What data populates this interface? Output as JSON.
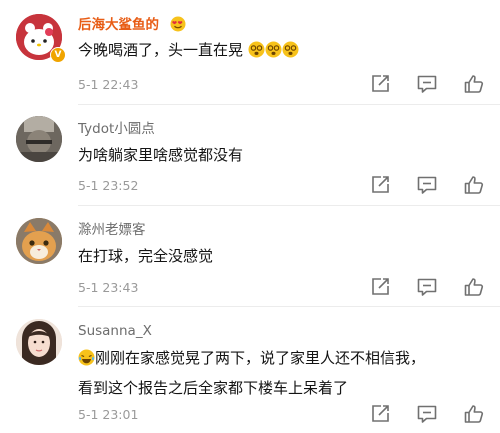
{
  "comments": [
    {
      "author": "后海大鲨鱼的",
      "author_color": "#e85d16",
      "text": "今晚喝酒了，头一直在晃",
      "trailing_emoji": [
        "dizzy-face",
        "dizzy-face",
        "dizzy-face"
      ],
      "time": "5-1 22:43",
      "verified": true
    },
    {
      "author": "Tydot小圆点",
      "text": "为啥躺家里啥感觉都没有",
      "time": "5-1 23:52"
    },
    {
      "author": "滁州老嫖客",
      "text": "在打球，完全没感觉",
      "time": "5-1 23:43"
    },
    {
      "author": "Susanna_X",
      "text_lines": [
        "刚刚在家感觉晃了两下，说了家里人还不相信我，",
        "看到这个报告之后全家都下楼车上呆着了"
      ],
      "leading_emoji": "laughing-tears-face",
      "time": "5-1 23:01"
    }
  ],
  "actions": [
    "share-icon",
    "comment-icon",
    "like-icon"
  ]
}
